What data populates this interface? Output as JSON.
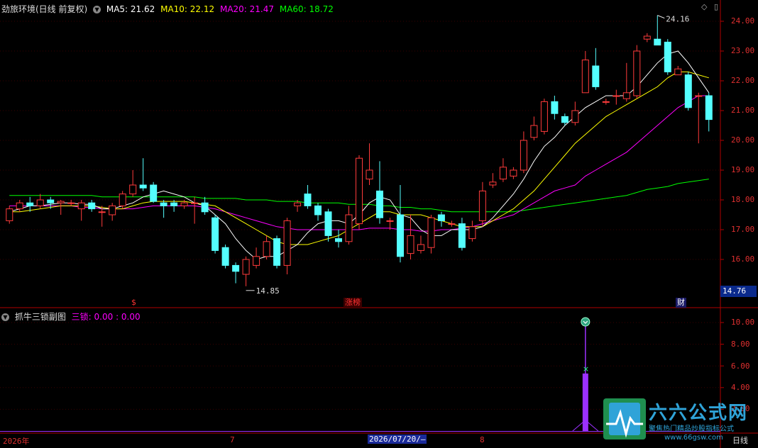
{
  "header": {
    "title": "劲旅环境(日线 前复权)",
    "ma5": "MA5: 21.62",
    "ma10": "MA10: 22.12",
    "ma20": "MA20: 21.47",
    "ma60": "MA60: 18.72"
  },
  "sub_header": {
    "title": "抓牛三锁副图",
    "label": "三锁: 0.00 : 0.00"
  },
  "colors": {
    "up": "#ff3b3b",
    "down": "#54ffff",
    "ma5": "#ffffff",
    "ma10": "#ffff00",
    "ma20": "#ff00ff",
    "ma60": "#00ff00",
    "axis": "#b00000",
    "purple": "#9b30ff"
  },
  "y_labels_main": [
    "24.00",
    "23.00",
    "22.00",
    "21.00",
    "20.00",
    "19.00",
    "18.00",
    "17.00",
    "16.00"
  ],
  "y_labels_sub": [
    "10.00",
    "8.00",
    "6.00",
    "4.00",
    "2.00"
  ],
  "current_price": "14.76",
  "annotations": {
    "high": "24.16",
    "low": "14.85"
  },
  "markers": [
    {
      "text": "$",
      "color": "#ff3333"
    },
    {
      "text": "涨榜",
      "color": "#ff3333"
    },
    {
      "text": "财",
      "color": "#ffffff"
    }
  ],
  "x_labels": [
    "2026年",
    "7",
    "8"
  ],
  "cursor_date": "2026/07/20/—",
  "period": "日线",
  "watermark": {
    "brand": "六六公式网",
    "slogan": "聚焦热门精品炒股指标公式",
    "url": "www.66gsw.com"
  },
  "chart_data": {
    "type": "candlestick",
    "candles": [
      [
        17.3,
        17.7,
        17.8,
        17.2
      ],
      [
        17.7,
        17.9,
        18.0,
        17.6
      ],
      [
        17.9,
        17.8,
        18.1,
        17.6
      ],
      [
        17.8,
        18.0,
        18.2,
        17.7
      ],
      [
        18.0,
        17.9,
        18.1,
        17.7
      ],
      [
        17.9,
        17.95,
        18.0,
        17.5
      ],
      [
        17.9,
        17.9,
        18.0,
        17.8
      ],
      [
        17.7,
        17.9,
        18.0,
        17.3
      ],
      [
        17.9,
        17.7,
        18.0,
        17.6
      ],
      [
        17.6,
        17.6,
        17.8,
        17.1
      ],
      [
        17.5,
        17.8,
        17.9,
        17.3
      ],
      [
        17.8,
        18.2,
        18.3,
        17.7
      ],
      [
        18.2,
        18.5,
        19.0,
        18.1
      ],
      [
        18.5,
        18.4,
        19.4,
        18.3
      ],
      [
        18.5,
        17.95,
        18.6,
        17.9
      ],
      [
        17.9,
        17.8,
        18.0,
        17.4
      ],
      [
        17.9,
        17.8,
        18.0,
        17.6
      ],
      [
        17.8,
        17.9,
        18.0,
        17.7
      ],
      [
        17.9,
        17.9,
        18.1,
        17.2
      ],
      [
        17.9,
        17.6,
        18.1,
        17.5
      ],
      [
        17.4,
        16.3,
        17.5,
        16.2
      ],
      [
        16.4,
        15.8,
        16.5,
        15.7
      ],
      [
        15.8,
        15.6,
        15.9,
        15.2
      ],
      [
        15.5,
        16.0,
        16.1,
        15.1
      ],
      [
        15.8,
        16.1,
        16.4,
        15.7
      ],
      [
        16.1,
        16.6,
        16.8,
        16.0
      ],
      [
        16.7,
        15.8,
        16.8,
        15.7
      ],
      [
        15.8,
        17.3,
        17.4,
        15.5
      ],
      [
        17.8,
        17.9,
        18.0,
        17.6
      ],
      [
        18.2,
        17.8,
        18.5,
        17.7
      ],
      [
        17.8,
        17.5,
        17.9,
        17.3
      ],
      [
        17.6,
        16.8,
        17.7,
        16.6
      ],
      [
        16.7,
        16.6,
        17.0,
        16.4
      ],
      [
        16.6,
        17.5,
        17.8,
        16.5
      ],
      [
        17.2,
        19.4,
        19.5,
        17.0
      ],
      [
        18.7,
        19.0,
        19.9,
        18.5
      ],
      [
        18.3,
        17.4,
        19.3,
        17.2
      ],
      [
        17.3,
        17.3,
        17.4,
        17.0
      ],
      [
        17.5,
        16.1,
        18.5,
        15.9
      ],
      [
        16.2,
        16.8,
        17.5,
        16.0
      ],
      [
        16.3,
        16.5,
        16.8,
        16.2
      ],
      [
        16.4,
        17.4,
        17.5,
        16.2
      ],
      [
        17.5,
        17.3,
        17.6,
        17.1
      ],
      [
        17.2,
        17.2,
        17.3,
        17.1
      ],
      [
        17.2,
        16.4,
        17.4,
        16.3
      ],
      [
        16.7,
        17.1,
        17.3,
        16.6
      ],
      [
        17.3,
        18.3,
        18.6,
        17.1
      ],
      [
        18.5,
        18.6,
        18.9,
        18.4
      ],
      [
        18.7,
        19.1,
        19.4,
        18.6
      ],
      [
        18.8,
        19.0,
        19.1,
        18.7
      ],
      [
        19.0,
        20.0,
        20.3,
        18.9
      ],
      [
        20.1,
        20.5,
        20.8,
        20.0
      ],
      [
        20.3,
        21.3,
        21.4,
        20.2
      ],
      [
        21.3,
        20.9,
        21.5,
        20.7
      ],
      [
        20.8,
        20.6,
        20.9,
        20.5
      ],
      [
        20.6,
        21.0,
        21.3,
        20.5
      ],
      [
        21.6,
        22.7,
        23.0,
        21.6
      ],
      [
        22.5,
        21.8,
        23.1,
        21.7
      ],
      [
        21.3,
        21.3,
        21.4,
        21.2
      ],
      [
        21.5,
        21.5,
        21.7,
        21.2
      ],
      [
        21.4,
        21.6,
        22.6,
        21.3
      ],
      [
        21.5,
        23.0,
        23.2,
        21.4
      ],
      [
        23.4,
        23.5,
        23.6,
        23.3
      ],
      [
        23.4,
        23.2,
        24.2,
        23.2
      ],
      [
        23.3,
        22.3,
        23.4,
        22.2
      ],
      [
        22.2,
        22.4,
        22.5,
        22.2
      ],
      [
        22.2,
        21.1,
        22.3,
        21.0
      ],
      [
        21.5,
        21.5,
        21.6,
        19.9
      ],
      [
        21.5,
        20.7,
        21.6,
        20.3
      ]
    ],
    "ma5": [
      17.6,
      17.7,
      17.8,
      17.8,
      17.85,
      17.9,
      17.9,
      17.85,
      17.85,
      17.7,
      17.7,
      17.8,
      17.9,
      18.1,
      18.2,
      18.3,
      18.2,
      18.1,
      17.9,
      17.8,
      17.5,
      17.2,
      16.7,
      16.3,
      16.0,
      16.1,
      16.1,
      16.3,
      16.5,
      16.9,
      17.2,
      17.3,
      17.3,
      17.2,
      17.5,
      17.9,
      18.1,
      18.0,
      17.5,
      17.4,
      17.0,
      16.8,
      16.8,
      17.0,
      17.0,
      17.0,
      17.1,
      17.4,
      17.8,
      18.2,
      18.7,
      19.3,
      19.8,
      20.1,
      20.5,
      20.8,
      21.1,
      21.3,
      21.5,
      21.5,
      21.5,
      21.8,
      22.2,
      22.6,
      22.9,
      23.0,
      22.6,
      22.1,
      21.6
    ],
    "ma10": [
      17.6,
      17.6,
      17.65,
      17.7,
      17.75,
      17.8,
      17.8,
      17.8,
      17.8,
      17.75,
      17.7,
      17.7,
      17.8,
      17.9,
      17.95,
      17.95,
      17.95,
      17.95,
      17.9,
      17.85,
      17.8,
      17.6,
      17.4,
      17.2,
      17.0,
      16.8,
      16.6,
      16.5,
      16.5,
      16.5,
      16.6,
      16.7,
      16.8,
      17.0,
      17.2,
      17.4,
      17.6,
      17.6,
      17.5,
      17.5,
      17.5,
      17.4,
      17.3,
      17.2,
      17.1,
      17.1,
      17.1,
      17.3,
      17.5,
      17.7,
      18.0,
      18.3,
      18.7,
      19.1,
      19.5,
      19.9,
      20.2,
      20.5,
      20.8,
      21.0,
      21.2,
      21.4,
      21.6,
      21.8,
      22.1,
      22.3,
      22.3,
      22.2,
      22.1
    ],
    "ma20": [
      17.8,
      17.8,
      17.8,
      17.8,
      17.8,
      17.8,
      17.8,
      17.75,
      17.75,
      17.7,
      17.7,
      17.7,
      17.7,
      17.75,
      17.8,
      17.8,
      17.8,
      17.8,
      17.8,
      17.75,
      17.7,
      17.6,
      17.5,
      17.4,
      17.3,
      17.2,
      17.1,
      17.05,
      17.0,
      17.0,
      17.0,
      17.0,
      17.0,
      17.0,
      17.0,
      17.05,
      17.05,
      17.05,
      17.0,
      17.0,
      16.95,
      16.95,
      17.0,
      17.0,
      17.05,
      17.1,
      17.2,
      17.3,
      17.4,
      17.5,
      17.7,
      17.9,
      18.1,
      18.3,
      18.4,
      18.5,
      18.8,
      19.0,
      19.2,
      19.4,
      19.6,
      19.9,
      20.2,
      20.5,
      20.8,
      21.1,
      21.3,
      21.5,
      21.5
    ],
    "ma60": [
      18.15,
      18.15,
      18.15,
      18.15,
      18.15,
      18.15,
      18.15,
      18.15,
      18.15,
      18.1,
      18.1,
      18.1,
      18.1,
      18.1,
      18.1,
      18.1,
      18.1,
      18.1,
      18.1,
      18.05,
      18.05,
      18.05,
      18.05,
      18.0,
      18.0,
      18.0,
      17.95,
      17.95,
      17.95,
      17.9,
      17.9,
      17.9,
      17.9,
      17.85,
      17.85,
      17.85,
      17.8,
      17.8,
      17.75,
      17.75,
      17.7,
      17.7,
      17.65,
      17.6,
      17.6,
      17.6,
      17.6,
      17.6,
      17.6,
      17.6,
      17.65,
      17.7,
      17.75,
      17.8,
      17.85,
      17.9,
      17.95,
      18.0,
      18.05,
      18.1,
      18.15,
      18.25,
      18.35,
      18.4,
      18.45,
      18.55,
      18.6,
      18.65,
      18.7
    ],
    "sub_spike": {
      "bar_index": 56,
      "top": 10.0,
      "mid": 5.3,
      "base": 0.0
    },
    "sub_ylim": [
      0,
      11
    ],
    "main_ylim": [
      14.5,
      24.5
    ]
  }
}
